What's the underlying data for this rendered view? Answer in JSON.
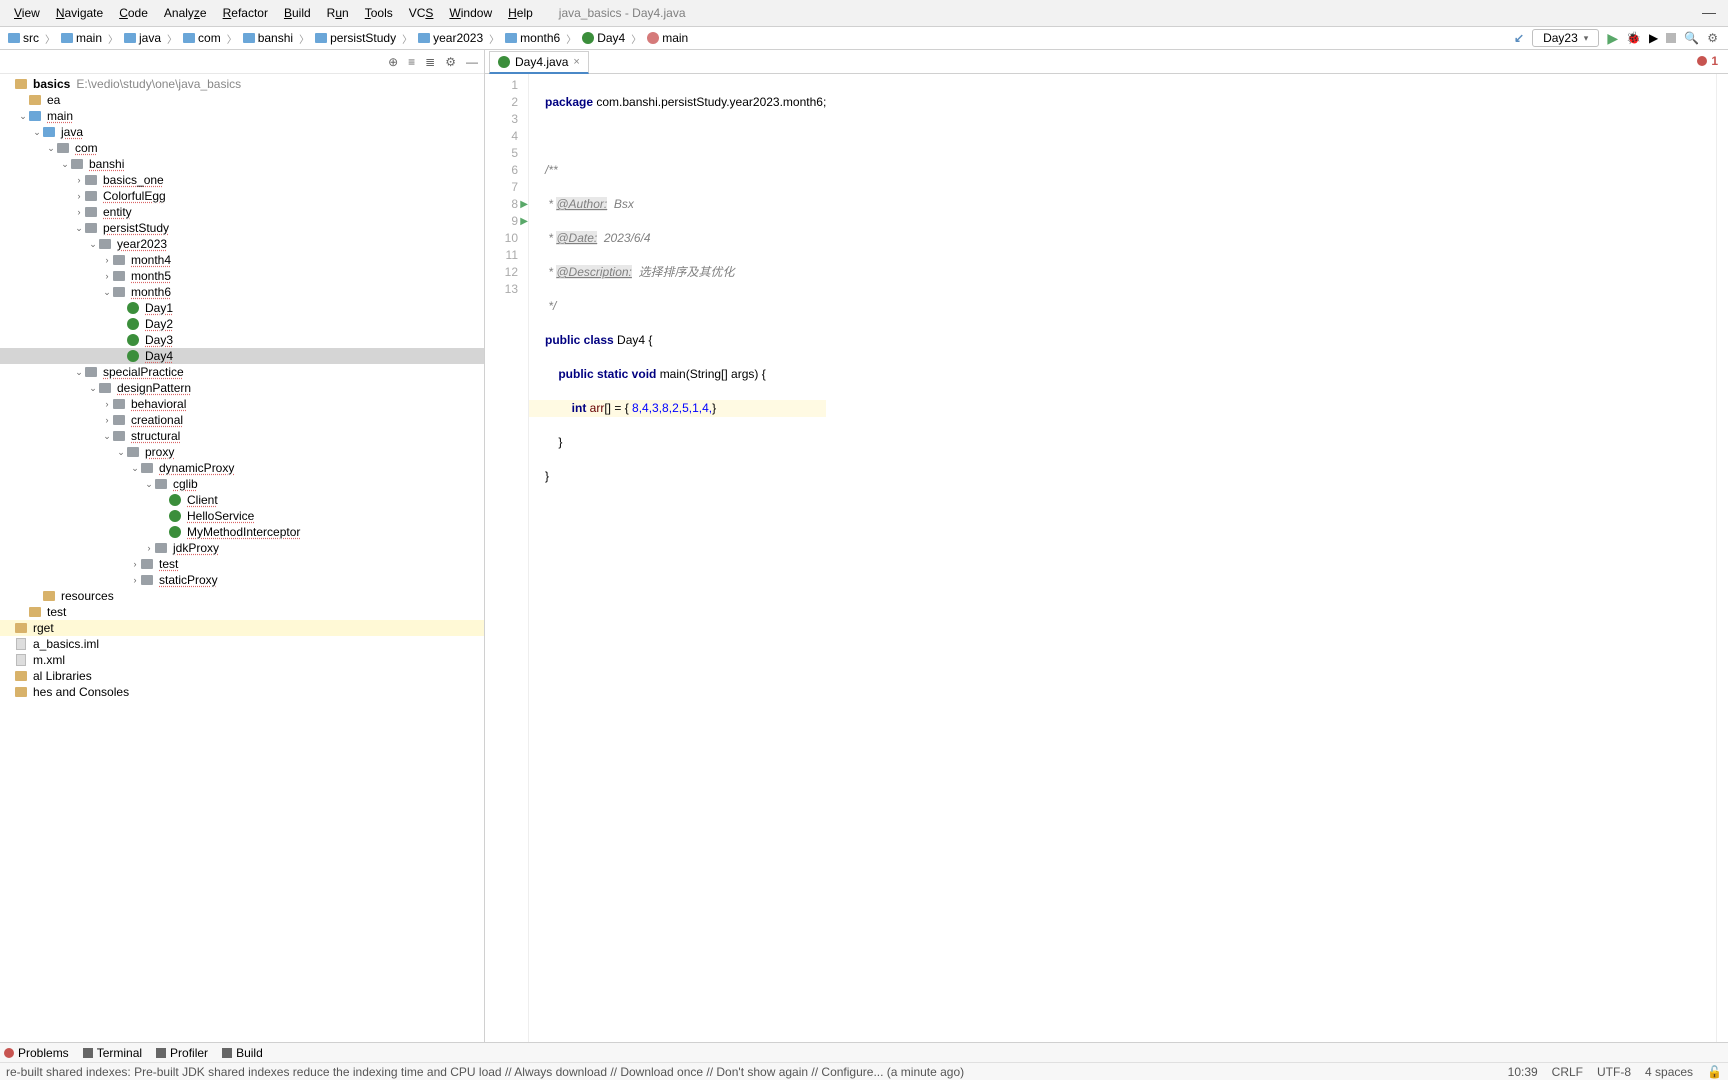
{
  "window": {
    "title": "java_basics - Day4.java"
  },
  "menu": {
    "items": [
      "View",
      "Navigate",
      "Code",
      "Analyze",
      "Refactor",
      "Build",
      "Run",
      "Tools",
      "VCS",
      "Window",
      "Help"
    ]
  },
  "breadcrumbs": {
    "parts": [
      "src",
      "main",
      "java",
      "com",
      "banshi",
      "persistStudy",
      "year2023",
      "month6",
      "Day4",
      "main"
    ]
  },
  "run_config": {
    "selected": "Day23"
  },
  "project": {
    "root_label": "basics",
    "root_path": "E:\\vedio\\study\\one\\java_basics",
    "nodes": [
      {
        "d": 0,
        "t": "root"
      },
      {
        "d": 1,
        "t": "folder",
        "l": "ea",
        "nou": true
      },
      {
        "d": 1,
        "t": "src",
        "l": "main",
        "tw": "v"
      },
      {
        "d": 2,
        "t": "src",
        "l": "java",
        "tw": "v"
      },
      {
        "d": 3,
        "t": "pkg",
        "l": "com",
        "tw": "v"
      },
      {
        "d": 4,
        "t": "pkg",
        "l": "banshi",
        "tw": "v"
      },
      {
        "d": 5,
        "t": "pkg",
        "l": "basics_one",
        "tw": ">"
      },
      {
        "d": 5,
        "t": "pkg",
        "l": "ColorfulEgg",
        "tw": ">"
      },
      {
        "d": 5,
        "t": "pkg",
        "l": "entity",
        "tw": ">"
      },
      {
        "d": 5,
        "t": "pkg",
        "l": "persistStudy",
        "tw": "v"
      },
      {
        "d": 6,
        "t": "pkg",
        "l": "year2023",
        "tw": "v"
      },
      {
        "d": 7,
        "t": "pkg",
        "l": "month4",
        "tw": ">"
      },
      {
        "d": 7,
        "t": "pkg",
        "l": "month5",
        "tw": ">"
      },
      {
        "d": 7,
        "t": "pkg",
        "l": "month6",
        "tw": "v"
      },
      {
        "d": 8,
        "t": "class",
        "l": "Day1"
      },
      {
        "d": 8,
        "t": "class",
        "l": "Day2"
      },
      {
        "d": 8,
        "t": "class",
        "l": "Day3"
      },
      {
        "d": 8,
        "t": "class",
        "l": "Day4",
        "sel": true
      },
      {
        "d": 5,
        "t": "pkg",
        "l": "specialPractice",
        "tw": "v"
      },
      {
        "d": 6,
        "t": "pkg",
        "l": "designPattern",
        "tw": "v"
      },
      {
        "d": 7,
        "t": "pkg",
        "l": "behavioral",
        "tw": ">"
      },
      {
        "d": 7,
        "t": "pkg",
        "l": "creational",
        "tw": ">"
      },
      {
        "d": 7,
        "t": "pkg",
        "l": "structural",
        "tw": "v"
      },
      {
        "d": 8,
        "t": "pkg",
        "l": "proxy",
        "tw": "v"
      },
      {
        "d": 9,
        "t": "pkg",
        "l": "dynamicProxy",
        "tw": "v"
      },
      {
        "d": 10,
        "t": "pkg",
        "l": "cglib",
        "tw": "v"
      },
      {
        "d": 11,
        "t": "class",
        "l": "Client"
      },
      {
        "d": 11,
        "t": "class",
        "l": "HelloService"
      },
      {
        "d": 11,
        "t": "class",
        "l": "MyMethodInterceptor"
      },
      {
        "d": 10,
        "t": "pkg",
        "l": "jdkProxy",
        "tw": ">"
      },
      {
        "d": 9,
        "t": "pkg",
        "l": "test",
        "tw": ">"
      },
      {
        "d": 9,
        "t": "pkg",
        "l": "staticProxy",
        "tw": ">"
      },
      {
        "d": 2,
        "t": "folder",
        "l": "resources",
        "nou": true
      },
      {
        "d": 1,
        "t": "folder",
        "l": "test",
        "nou": true
      },
      {
        "d": 0,
        "t": "folder",
        "l": "rget",
        "hl": true,
        "nou": true
      },
      {
        "d": 0,
        "t": "file",
        "l": "a_basics.iml",
        "nou": true
      },
      {
        "d": 0,
        "t": "file",
        "l": "m.xml",
        "nou": true
      },
      {
        "d": 0,
        "t": "lib",
        "l": "al Libraries",
        "nou": true
      },
      {
        "d": 0,
        "t": "lib",
        "l": "hes and Consoles",
        "nou": true
      }
    ]
  },
  "tab": {
    "label": "Day4.java"
  },
  "editor_lines": {
    "l1": {
      "pkg": "package",
      "path": "com.banshi.persistStudy.year2023.month6;"
    },
    "l3": "/**",
    "l4": {
      "pre": " * ",
      "tag": "@Author:",
      "val": "  Bsx"
    },
    "l5": {
      "pre": " * ",
      "tag": "@Date:",
      "val": "  2023/6/4"
    },
    "l6": {
      "pre": " * ",
      "tag": "@Description:",
      "val": "  选择排序及其优化"
    },
    "l7": " */",
    "l8": {
      "a": "public ",
      "b": "class ",
      "c": "Day4 {"
    },
    "l9": {
      "a": "    public static void ",
      "b": "main",
      "c": "(String[] args) {"
    },
    "l10": {
      "a": "        int ",
      "b": "arr",
      "c": "[] = { ",
      "d": "8,4,3,8,2,5,1,4,",
      "e": "}"
    },
    "l11": "    }",
    "l12": "}"
  },
  "errors": {
    "count": "1"
  },
  "bottom": {
    "problems": "Problems",
    "terminal": "Terminal",
    "profiler": "Profiler",
    "build": "Build"
  },
  "status": {
    "message": "re-built shared indexes: Pre-built JDK shared indexes reduce the indexing time and CPU load // Always download // Download once // Don't show again // Configure... (a minute ago)",
    "pos": "10:39",
    "sep": "CRLF",
    "enc": "UTF-8",
    "indent": "4 spaces"
  }
}
